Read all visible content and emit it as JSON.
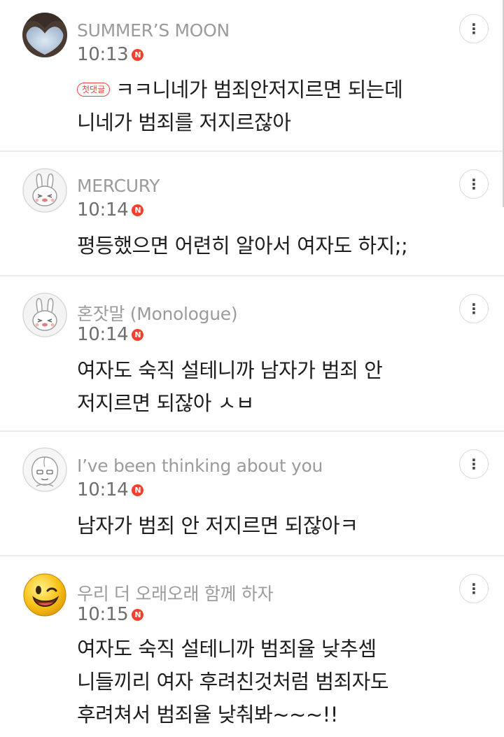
{
  "comments": [
    {
      "author": "SUMMER’S MOON",
      "time": "10:13",
      "new_badge": "N",
      "first_badge": "첫댓글",
      "lines": [
        "ㅋㅋ니네가 범죄안저지르면 되는데",
        "니네가 범죄를 저지르잖아"
      ],
      "avatar": "heart-hands-avatar-icon"
    },
    {
      "author": "MERCURY",
      "time": "10:14",
      "new_badge": "N",
      "lines": [
        "평등했으면 어련히 알아서 여자도 하지;;"
      ],
      "avatar": "rabbit-avatar-icon"
    },
    {
      "author": "혼잣말 (Monologue)",
      "time": "10:14",
      "new_badge": "N",
      "lines": [
        "여자도 숙직 설테니까 남자가 범죄 안",
        "저지르면 되잖아 ㅅㅂ"
      ],
      "avatar": "rabbit-avatar-icon"
    },
    {
      "author": "I’ve been thinking about you",
      "time": "10:14",
      "new_badge": "N",
      "lines": [
        "남자가 범죄 안 저지르면 되잖아ㅋ"
      ],
      "avatar": "peach-avatar-icon"
    },
    {
      "author": "우리 더 오래오래 함께 하자",
      "time": "10:15",
      "new_badge": "N",
      "lines": [
        "여자도 숙직 설테니까 범죄율 낮추셈",
        "니들끼리 여자 후려친것처럼 범죄자도",
        "후려쳐서 범죄율 낮춰봐~~~!!"
      ],
      "avatar": "winking-smiley-avatar-icon"
    }
  ],
  "more_icon": "⋮",
  "colors": {
    "new_badge": "#f0412f",
    "first_badge": "#e8453c",
    "author": "#9b9b9b",
    "divider": "#ececec"
  }
}
